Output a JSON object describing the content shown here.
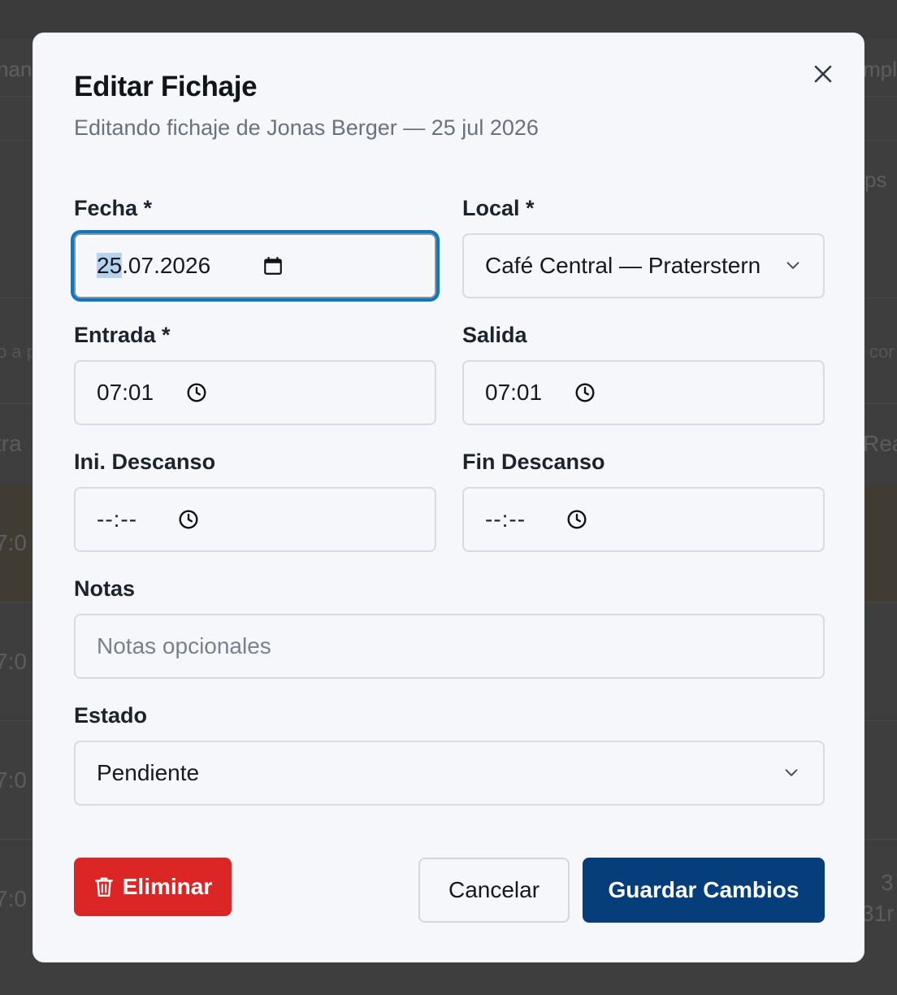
{
  "background": {
    "fragments": {
      "f1": "nan",
      "f2": "mpl",
      "f3": "ps",
      "f4": "o a p",
      "f5": "cor",
      "f6": "tra",
      "f7": "Rea",
      "f8": "7:0",
      "f9": "7:0",
      "f10": "7:0",
      "f11": "7:0",
      "f12": "3",
      "f13": "31r"
    }
  },
  "modal": {
    "title": "Editar Fichaje",
    "subtitle": "Editando fichaje de Jonas Berger — 25 jul 2026",
    "close_icon": "close-icon"
  },
  "form": {
    "fecha": {
      "label": "Fecha *",
      "day": "25",
      "rest": ".07.2026",
      "icon": "calendar-icon"
    },
    "local": {
      "label": "Local *",
      "value": "Café Central — Praterstern",
      "icon": "chevron-down-icon"
    },
    "entrada": {
      "label": "Entrada *",
      "value": "07:01",
      "icon": "clock-icon"
    },
    "salida": {
      "label": "Salida",
      "value": "07:01",
      "icon": "clock-icon"
    },
    "ini_descanso": {
      "label": "Ini. Descanso",
      "value": "--:--",
      "icon": "clock-icon"
    },
    "fin_descanso": {
      "label": "Fin Descanso",
      "value": "--:--",
      "icon": "clock-icon"
    },
    "notas": {
      "label": "Notas",
      "placeholder": "Notas opcionales"
    },
    "estado": {
      "label": "Estado",
      "value": "Pendiente",
      "icon": "chevron-down-icon"
    }
  },
  "actions": {
    "delete_label": "Eliminar",
    "cancel_label": "Cancelar",
    "save_label": "Guardar Cambios"
  },
  "colors": {
    "primary": "#053e7a",
    "danger": "#dc2626",
    "focus_ring": "#0a78c2"
  }
}
